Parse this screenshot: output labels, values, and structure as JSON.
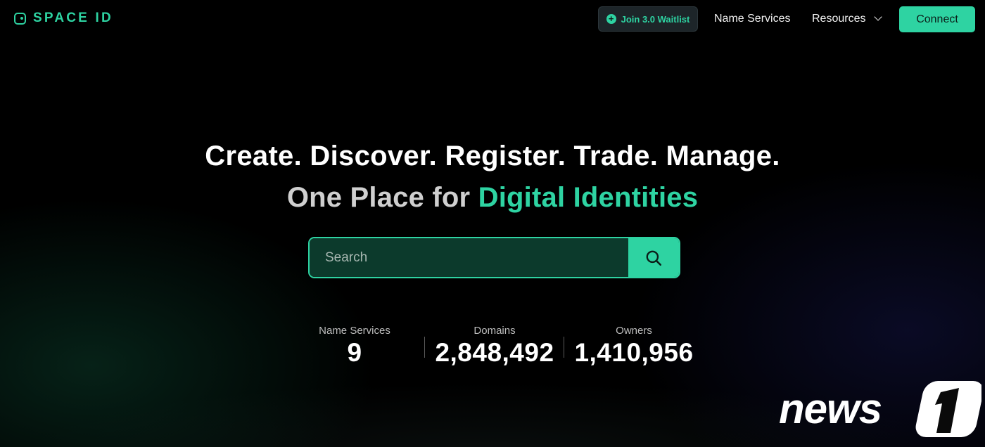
{
  "header": {
    "logo_text": "SPACE ID",
    "waitlist_label": "Join 3.0 Waitlist",
    "nav": [
      {
        "label": "Name Services"
      },
      {
        "label": "Resources"
      }
    ],
    "connect_label": "Connect"
  },
  "hero": {
    "headline": "Create. Discover. Register. Trade. Manage.",
    "subline_prefix": "One Place for ",
    "subline_accent": "Digital Identities"
  },
  "search": {
    "placeholder": "Search",
    "value": ""
  },
  "stats": [
    {
      "label": "Name Services",
      "value": "9"
    },
    {
      "label": "Domains",
      "value": "2,848,492"
    },
    {
      "label": "Owners",
      "value": "1,410,956"
    }
  ],
  "watermark": {
    "text": "news1"
  },
  "colors": {
    "accent": "#2ed3a2",
    "background": "#000000",
    "search_bg": "#0c3a2c",
    "waitlist_bg": "#1d2529"
  },
  "icons": [
    "logo-icon",
    "plus-circle-icon",
    "chevron-down-icon",
    "search-icon"
  ]
}
